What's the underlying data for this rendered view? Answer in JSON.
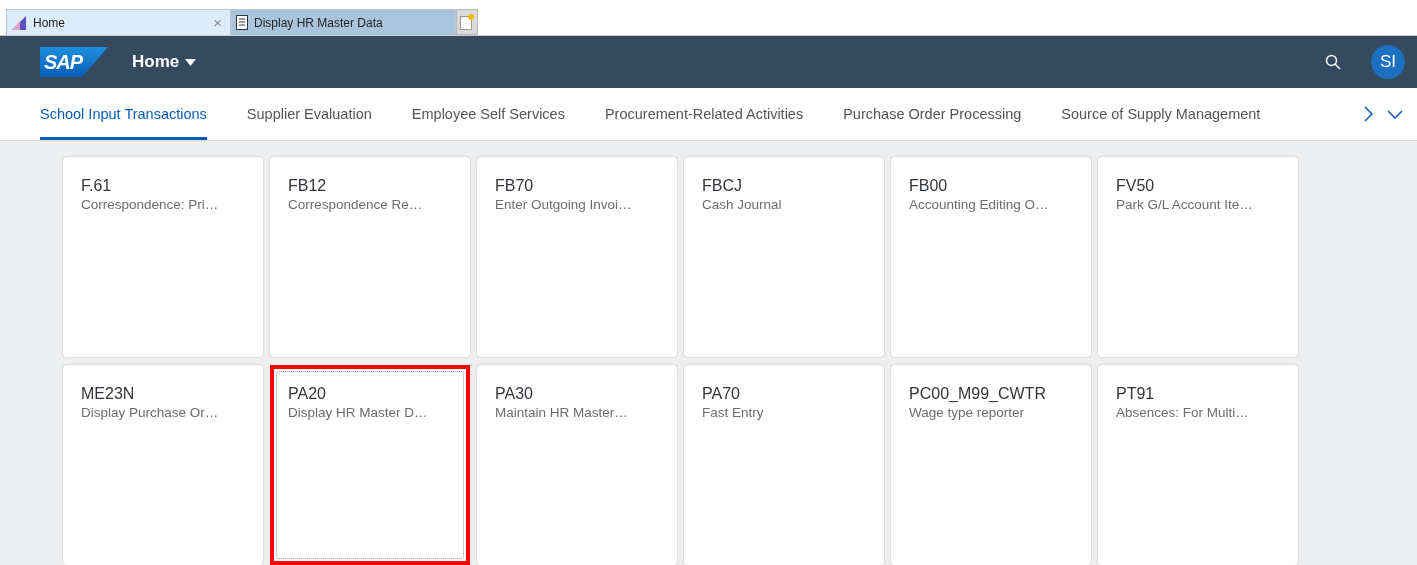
{
  "browser_tabs": [
    {
      "title": "Home",
      "selected": true,
      "close": "×"
    },
    {
      "title": "Display HR Master Data",
      "selected": false
    }
  ],
  "shell_bar": {
    "logo": "SAP",
    "title": "Home",
    "avatar": "SI"
  },
  "groups": [
    {
      "label": "School Input Transactions",
      "selected": true
    },
    {
      "label": "Supplier Evaluation",
      "selected": false
    },
    {
      "label": "Employee Self Services",
      "selected": false
    },
    {
      "label": "Procurement-Related Activities",
      "selected": false
    },
    {
      "label": "Purchase Order Processing",
      "selected": false
    },
    {
      "label": "Source of Supply Management",
      "selected": false
    }
  ],
  "tiles": [
    {
      "title": "F.61",
      "subtitle": "Correspondence: Pri…",
      "highlighted": false
    },
    {
      "title": "FB12",
      "subtitle": "Correspondence Re…",
      "highlighted": false
    },
    {
      "title": "FB70",
      "subtitle": "Enter Outgoing Invoi…",
      "highlighted": false
    },
    {
      "title": "FBCJ",
      "subtitle": "Cash Journal",
      "highlighted": false
    },
    {
      "title": "FB00",
      "subtitle": "Accounting Editing O…",
      "highlighted": false
    },
    {
      "title": "FV50",
      "subtitle": "Park G/L Account Ite…",
      "highlighted": false
    },
    {
      "title": "ME23N",
      "subtitle": "Display Purchase Or…",
      "highlighted": false
    },
    {
      "title": "PA20",
      "subtitle": "Display HR Master D…",
      "highlighted": true
    },
    {
      "title": "PA30",
      "subtitle": "Maintain HR Master…",
      "highlighted": false
    },
    {
      "title": "PA70",
      "subtitle": "Fast Entry",
      "highlighted": false
    },
    {
      "title": "PC00_M99_CWTR",
      "subtitle": "Wage type reporter",
      "highlighted": false
    },
    {
      "title": "PT91",
      "subtitle": "Absences: For Multi…",
      "highlighted": false
    }
  ]
}
